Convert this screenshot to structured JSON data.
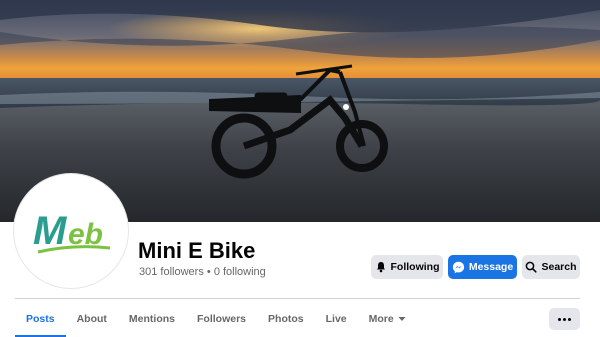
{
  "page": {
    "name": "Mini E Bike",
    "followers": "301 followers",
    "separator": "•",
    "following": "0 following"
  },
  "avatar": {
    "logo_text_m": "M",
    "logo_text_rest": "eb"
  },
  "actions": {
    "following_label": "Following",
    "message_label": "Message",
    "search_label": "Search"
  },
  "tabs": [
    {
      "label": "Posts",
      "active": true
    },
    {
      "label": "About"
    },
    {
      "label": "Mentions"
    },
    {
      "label": "Followers"
    },
    {
      "label": "Photos"
    },
    {
      "label": "Live"
    },
    {
      "label": "More"
    }
  ],
  "colors": {
    "accent": "#1b74e4",
    "button_gray": "#e4e6eb",
    "logo_teal": "#2a9d8f",
    "logo_green": "#7cc242"
  }
}
